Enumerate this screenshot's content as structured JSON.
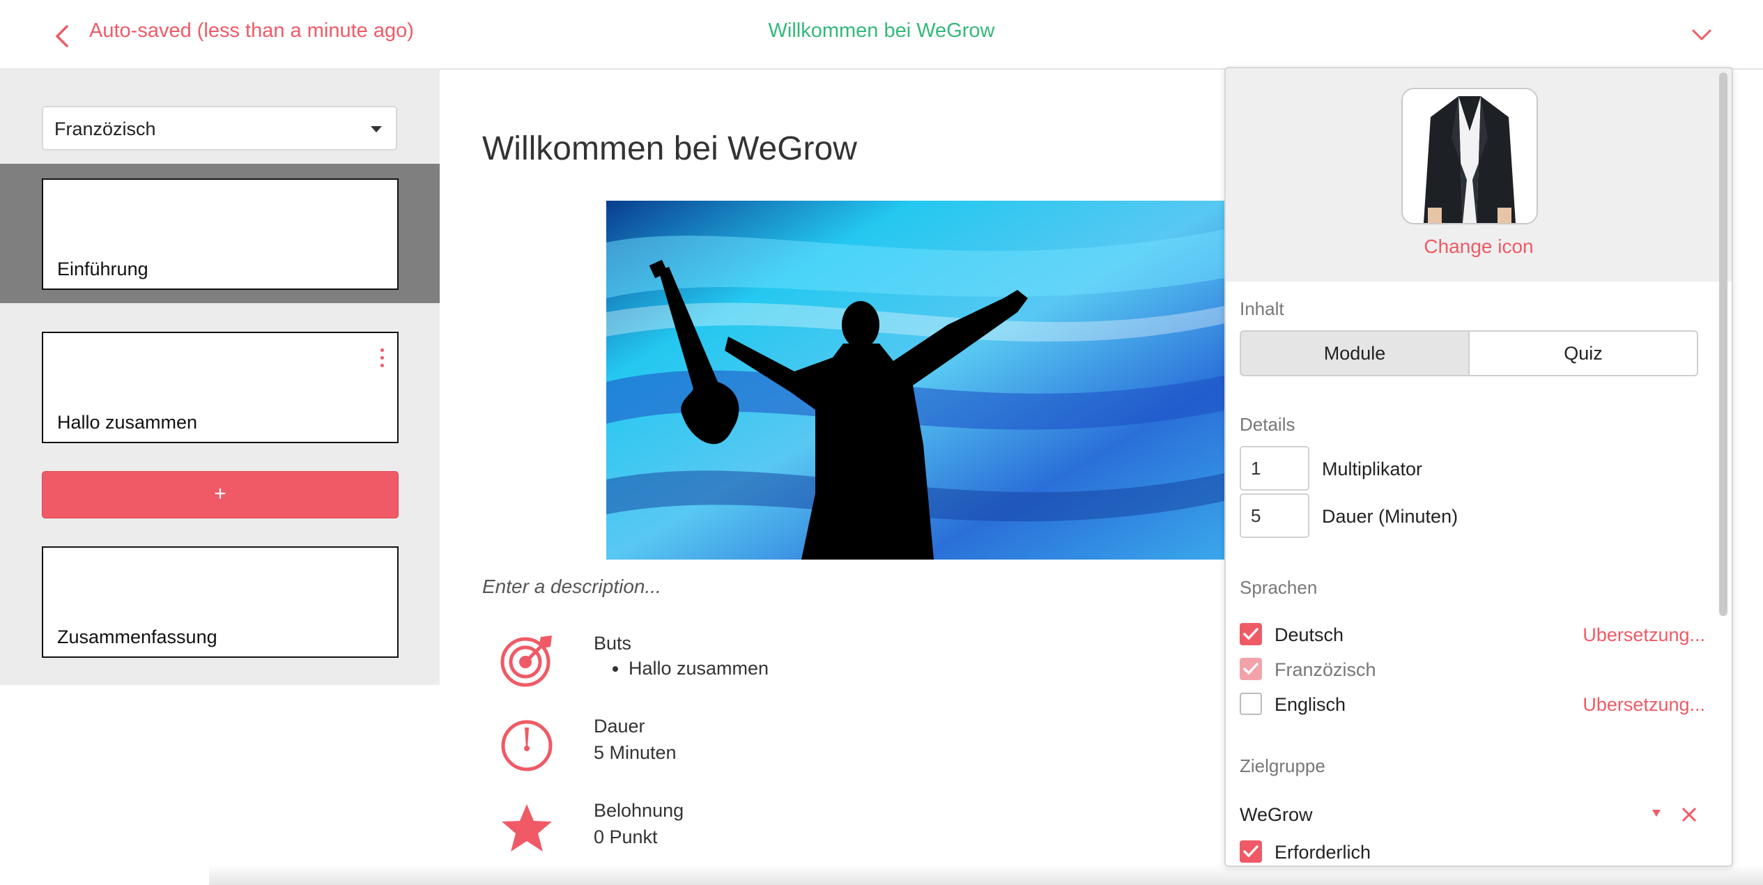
{
  "header": {
    "autosave_text": "Auto-saved (less than a minute ago)",
    "title": "Willkommen bei WeGrow"
  },
  "sidebar": {
    "language": "Franzözisch",
    "cards": [
      "Einführung",
      "Hallo zusammen",
      "Zusammenfassung"
    ],
    "add_label": "+"
  },
  "main": {
    "title": "Willkommen bei WeGrow",
    "description_placeholder": "Enter a description...",
    "goals_heading": "Buts",
    "goals": [
      "Hallo zusammen"
    ],
    "duration_heading": "Dauer",
    "duration_value": "5 Minuten",
    "reward_heading": "Belohnung",
    "reward_value": "0 Punkt"
  },
  "panel": {
    "change_icon": "Change icon",
    "content_label": "Inhalt",
    "content_options": [
      "Module",
      "Quiz"
    ],
    "content_selected": "Module",
    "details_label": "Details",
    "multiplier_value": "1",
    "multiplier_label": "Multiplikator",
    "duration_value": "5",
    "duration_label": "Dauer (Minuten)",
    "languages_label": "Sprachen",
    "languages": [
      {
        "name": "Deutsch",
        "checked": true,
        "link": "Ubersetzung..."
      },
      {
        "name": "Franzözisch",
        "checked": true,
        "link": ""
      },
      {
        "name": "Englisch",
        "checked": false,
        "link": "Ubersetzung..."
      }
    ],
    "target_label": "Zielgruppe",
    "target_value": "WeGrow",
    "required_label": "Erforderlich",
    "required_checked": true
  },
  "colors": {
    "accent": "#ef5a66",
    "title_green": "#34b87a",
    "sidebar_bg": "#ececec",
    "active_band": "#7f7f7f"
  }
}
